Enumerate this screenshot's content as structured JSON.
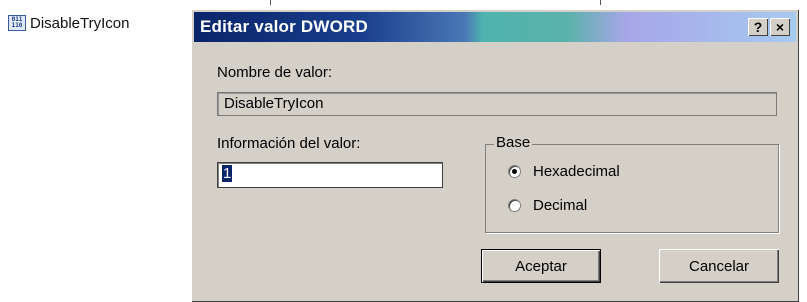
{
  "registry_list": {
    "item_label": "DisableTryIcon"
  },
  "dialog": {
    "title": "Editar valor DWORD",
    "help_button": "?",
    "close_button": "×",
    "value_name_label": "Nombre de valor:",
    "value_name": "DisableTryIcon",
    "value_data_label": "Información del valor:",
    "value_data": "1",
    "base": {
      "title": "Base",
      "options": [
        "Hexadecimal",
        "Decimal"
      ],
      "selected": "Hexadecimal"
    },
    "ok_button": "Aceptar",
    "cancel_button": "Cancelar"
  }
}
